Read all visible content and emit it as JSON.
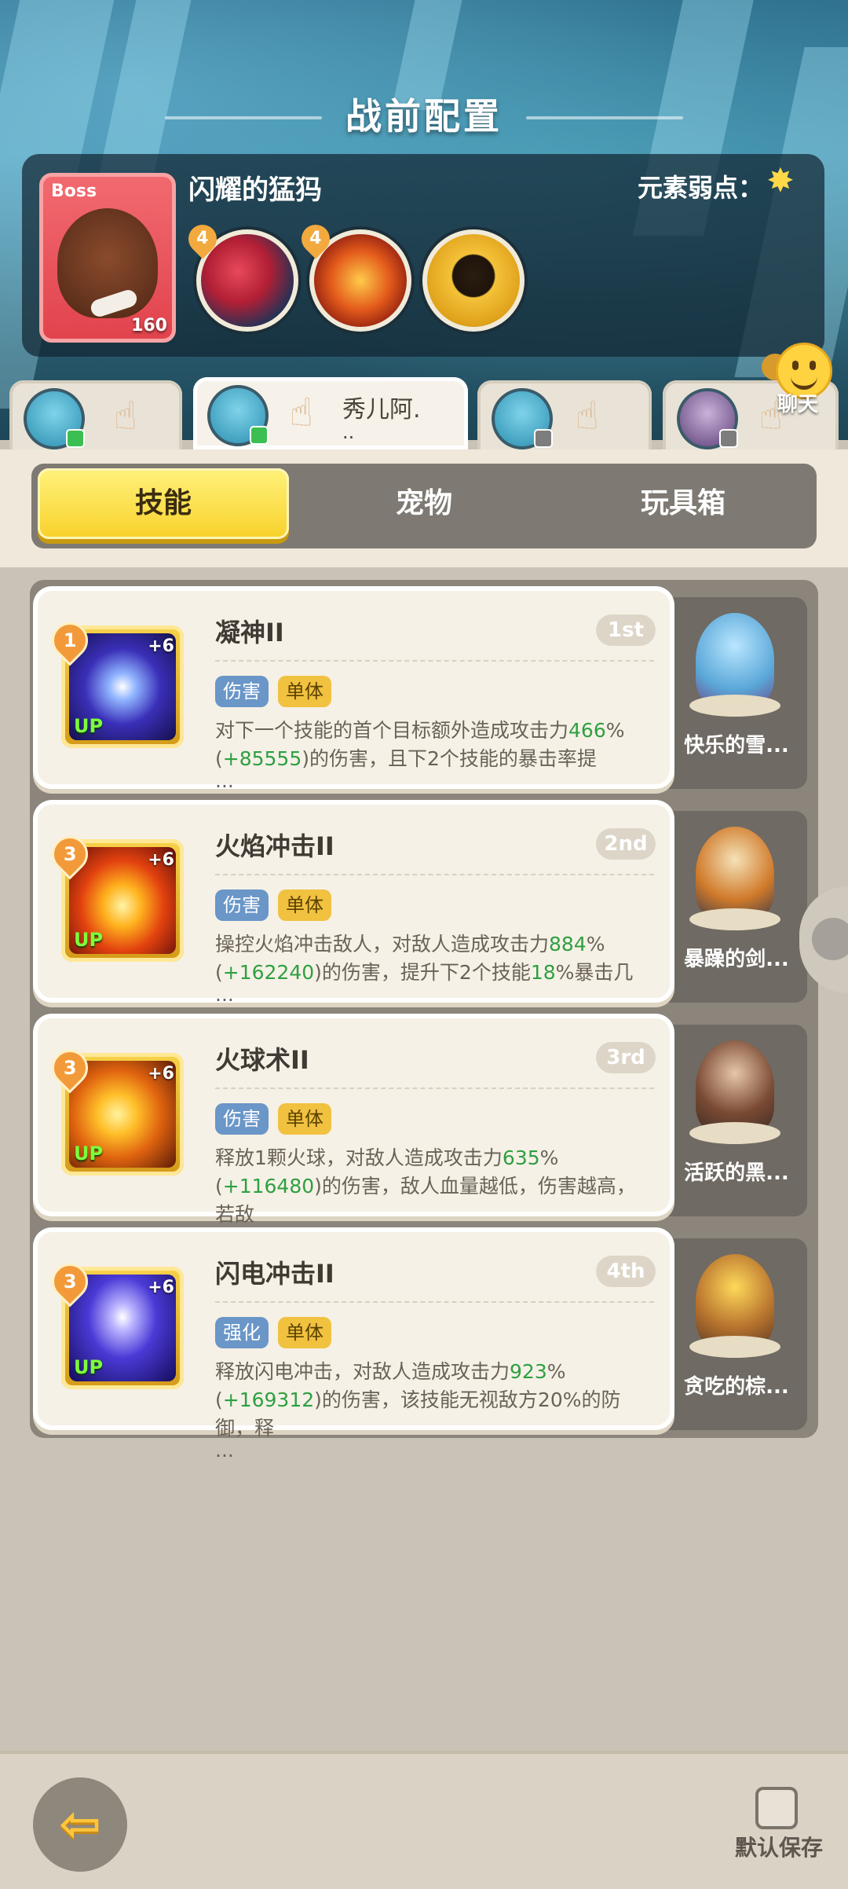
{
  "header": {
    "title": "战前配置"
  },
  "boss": {
    "tag": "Boss",
    "name": "闪耀的猛犸",
    "level": "160",
    "weakness_label": "元素弱点：",
    "weakness_icon": "star-icon",
    "skills": [
      {
        "badge": "4",
        "icon": "bite-icon"
      },
      {
        "badge": "4",
        "icon": "fire-swipe-icon"
      },
      {
        "badge": "",
        "icon": "beast-head-icon"
      }
    ]
  },
  "team_tabs": [
    {
      "name": "",
      "name2": "",
      "active": false
    },
    {
      "name": "秀儿阿.",
      "name2": "..",
      "active": true
    },
    {
      "name": "",
      "name2": "",
      "active": false
    },
    {
      "name": "",
      "name2": "",
      "active": false
    }
  ],
  "chat": {
    "label": "聊天"
  },
  "segments": {
    "skills": "技能",
    "pets": "宠物",
    "toybox": "玩具箱"
  },
  "skills": [
    {
      "level": "1",
      "plus": "+6",
      "up": "UP",
      "title": "凝神II",
      "order": "1st",
      "tags": [
        "伤害",
        "单体"
      ],
      "desc_a": "对下一个技能的首个目标额外造成攻击力",
      "desc_num1": "466",
      "desc_b": "%(",
      "desc_num2": "+85555",
      "desc_c": ")的伤害，且下2个技能的暴击率提",
      "desc_more": "...",
      "pet": "快乐的雪..."
    },
    {
      "level": "3",
      "plus": "+6",
      "up": "UP",
      "title": "火焰冲击II",
      "order": "2nd",
      "tags": [
        "伤害",
        "单体"
      ],
      "desc_a": "操控火焰冲击敌人，对敌人造成攻击力",
      "desc_num1": "884",
      "desc_b": "%(",
      "desc_num2": "+162240",
      "desc_c": ")的伤害，提升下2个技能",
      "desc_num3": "18",
      "desc_d": "%暴击几",
      "desc_more": "...",
      "pet": "暴躁的剑..."
    },
    {
      "level": "3",
      "plus": "+6",
      "up": "UP",
      "title": "火球术II",
      "order": "3rd",
      "tags": [
        "伤害",
        "单体"
      ],
      "desc_a": "释放1颗火球，对敌人造成攻击力",
      "desc_num1": "635",
      "desc_b": "%(",
      "desc_num2": "+116480",
      "desc_c": ")的伤害，敌人血量越低，伤害越高，若敌",
      "desc_more": "...",
      "pet": "活跃的黑..."
    },
    {
      "level": "3",
      "plus": "+6",
      "up": "UP",
      "title": "闪电冲击II",
      "order": "4th",
      "tags": [
        "强化",
        "单体"
      ],
      "desc_a": "释放闪电冲击，对敌人造成攻击力",
      "desc_num1": "923",
      "desc_b": "%(",
      "desc_num2": "+169312",
      "desc_c": ")的伤害，该技能无视敌方20%的防御，释",
      "desc_more": "...",
      "pet": "贪吃的棕..."
    }
  ],
  "footer": {
    "save_label": "默认保存"
  }
}
